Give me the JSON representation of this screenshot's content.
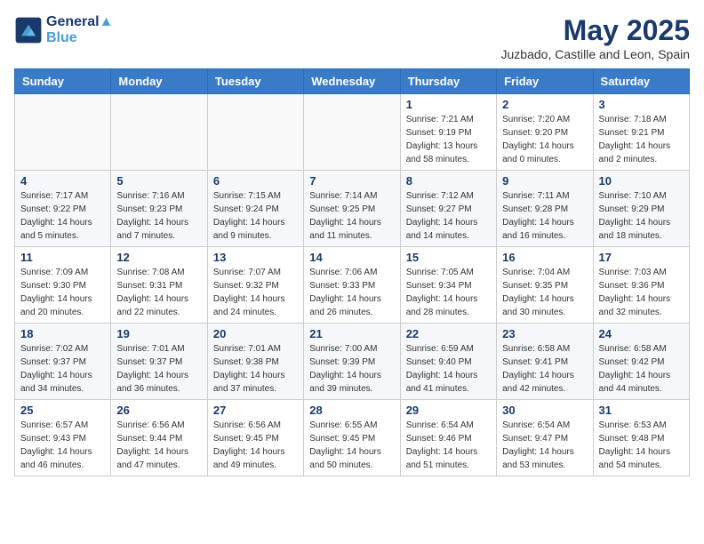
{
  "header": {
    "logo_line1": "General",
    "logo_line2": "Blue",
    "month": "May 2025",
    "location": "Juzbado, Castille and Leon, Spain"
  },
  "weekdays": [
    "Sunday",
    "Monday",
    "Tuesday",
    "Wednesday",
    "Thursday",
    "Friday",
    "Saturday"
  ],
  "weeks": [
    [
      {
        "day": "",
        "sunrise": "",
        "sunset": "",
        "daylight": ""
      },
      {
        "day": "",
        "sunrise": "",
        "sunset": "",
        "daylight": ""
      },
      {
        "day": "",
        "sunrise": "",
        "sunset": "",
        "daylight": ""
      },
      {
        "day": "",
        "sunrise": "",
        "sunset": "",
        "daylight": ""
      },
      {
        "day": "1",
        "sunrise": "Sunrise: 7:21 AM",
        "sunset": "Sunset: 9:19 PM",
        "daylight": "Daylight: 13 hours and 58 minutes."
      },
      {
        "day": "2",
        "sunrise": "Sunrise: 7:20 AM",
        "sunset": "Sunset: 9:20 PM",
        "daylight": "Daylight: 14 hours and 0 minutes."
      },
      {
        "day": "3",
        "sunrise": "Sunrise: 7:18 AM",
        "sunset": "Sunset: 9:21 PM",
        "daylight": "Daylight: 14 hours and 2 minutes."
      }
    ],
    [
      {
        "day": "4",
        "sunrise": "Sunrise: 7:17 AM",
        "sunset": "Sunset: 9:22 PM",
        "daylight": "Daylight: 14 hours and 5 minutes."
      },
      {
        "day": "5",
        "sunrise": "Sunrise: 7:16 AM",
        "sunset": "Sunset: 9:23 PM",
        "daylight": "Daylight: 14 hours and 7 minutes."
      },
      {
        "day": "6",
        "sunrise": "Sunrise: 7:15 AM",
        "sunset": "Sunset: 9:24 PM",
        "daylight": "Daylight: 14 hours and 9 minutes."
      },
      {
        "day": "7",
        "sunrise": "Sunrise: 7:14 AM",
        "sunset": "Sunset: 9:25 PM",
        "daylight": "Daylight: 14 hours and 11 minutes."
      },
      {
        "day": "8",
        "sunrise": "Sunrise: 7:12 AM",
        "sunset": "Sunset: 9:27 PM",
        "daylight": "Daylight: 14 hours and 14 minutes."
      },
      {
        "day": "9",
        "sunrise": "Sunrise: 7:11 AM",
        "sunset": "Sunset: 9:28 PM",
        "daylight": "Daylight: 14 hours and 16 minutes."
      },
      {
        "day": "10",
        "sunrise": "Sunrise: 7:10 AM",
        "sunset": "Sunset: 9:29 PM",
        "daylight": "Daylight: 14 hours and 18 minutes."
      }
    ],
    [
      {
        "day": "11",
        "sunrise": "Sunrise: 7:09 AM",
        "sunset": "Sunset: 9:30 PM",
        "daylight": "Daylight: 14 hours and 20 minutes."
      },
      {
        "day": "12",
        "sunrise": "Sunrise: 7:08 AM",
        "sunset": "Sunset: 9:31 PM",
        "daylight": "Daylight: 14 hours and 22 minutes."
      },
      {
        "day": "13",
        "sunrise": "Sunrise: 7:07 AM",
        "sunset": "Sunset: 9:32 PM",
        "daylight": "Daylight: 14 hours and 24 minutes."
      },
      {
        "day": "14",
        "sunrise": "Sunrise: 7:06 AM",
        "sunset": "Sunset: 9:33 PM",
        "daylight": "Daylight: 14 hours and 26 minutes."
      },
      {
        "day": "15",
        "sunrise": "Sunrise: 7:05 AM",
        "sunset": "Sunset: 9:34 PM",
        "daylight": "Daylight: 14 hours and 28 minutes."
      },
      {
        "day": "16",
        "sunrise": "Sunrise: 7:04 AM",
        "sunset": "Sunset: 9:35 PM",
        "daylight": "Daylight: 14 hours and 30 minutes."
      },
      {
        "day": "17",
        "sunrise": "Sunrise: 7:03 AM",
        "sunset": "Sunset: 9:36 PM",
        "daylight": "Daylight: 14 hours and 32 minutes."
      }
    ],
    [
      {
        "day": "18",
        "sunrise": "Sunrise: 7:02 AM",
        "sunset": "Sunset: 9:37 PM",
        "daylight": "Daylight: 14 hours and 34 minutes."
      },
      {
        "day": "19",
        "sunrise": "Sunrise: 7:01 AM",
        "sunset": "Sunset: 9:37 PM",
        "daylight": "Daylight: 14 hours and 36 minutes."
      },
      {
        "day": "20",
        "sunrise": "Sunrise: 7:01 AM",
        "sunset": "Sunset: 9:38 PM",
        "daylight": "Daylight: 14 hours and 37 minutes."
      },
      {
        "day": "21",
        "sunrise": "Sunrise: 7:00 AM",
        "sunset": "Sunset: 9:39 PM",
        "daylight": "Daylight: 14 hours and 39 minutes."
      },
      {
        "day": "22",
        "sunrise": "Sunrise: 6:59 AM",
        "sunset": "Sunset: 9:40 PM",
        "daylight": "Daylight: 14 hours and 41 minutes."
      },
      {
        "day": "23",
        "sunrise": "Sunrise: 6:58 AM",
        "sunset": "Sunset: 9:41 PM",
        "daylight": "Daylight: 14 hours and 42 minutes."
      },
      {
        "day": "24",
        "sunrise": "Sunrise: 6:58 AM",
        "sunset": "Sunset: 9:42 PM",
        "daylight": "Daylight: 14 hours and 44 minutes."
      }
    ],
    [
      {
        "day": "25",
        "sunrise": "Sunrise: 6:57 AM",
        "sunset": "Sunset: 9:43 PM",
        "daylight": "Daylight: 14 hours and 46 minutes."
      },
      {
        "day": "26",
        "sunrise": "Sunrise: 6:56 AM",
        "sunset": "Sunset: 9:44 PM",
        "daylight": "Daylight: 14 hours and 47 minutes."
      },
      {
        "day": "27",
        "sunrise": "Sunrise: 6:56 AM",
        "sunset": "Sunset: 9:45 PM",
        "daylight": "Daylight: 14 hours and 49 minutes."
      },
      {
        "day": "28",
        "sunrise": "Sunrise: 6:55 AM",
        "sunset": "Sunset: 9:45 PM",
        "daylight": "Daylight: 14 hours and 50 minutes."
      },
      {
        "day": "29",
        "sunrise": "Sunrise: 6:54 AM",
        "sunset": "Sunset: 9:46 PM",
        "daylight": "Daylight: 14 hours and 51 minutes."
      },
      {
        "day": "30",
        "sunrise": "Sunrise: 6:54 AM",
        "sunset": "Sunset: 9:47 PM",
        "daylight": "Daylight: 14 hours and 53 minutes."
      },
      {
        "day": "31",
        "sunrise": "Sunrise: 6:53 AM",
        "sunset": "Sunset: 9:48 PM",
        "daylight": "Daylight: 14 hours and 54 minutes."
      }
    ]
  ]
}
